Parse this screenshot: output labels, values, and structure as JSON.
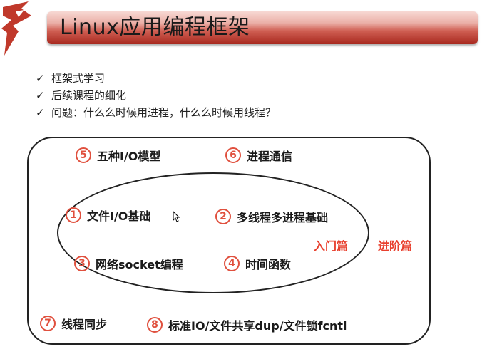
{
  "slide": {
    "title": "Linux应用编程框架",
    "bullets": [
      {
        "check": "✓",
        "text": "框架式学习"
      },
      {
        "check": "✓",
        "text": "后续课程的细化"
      },
      {
        "check": "✓",
        "text": "问题：什么么时候用进程，什么么时候用线程？"
      }
    ],
    "diagram": {
      "items": [
        {
          "num": "5",
          "label": "五种I/O模型"
        },
        {
          "num": "6",
          "label": "进程通信"
        },
        {
          "num": "1",
          "label": "文件I/O基础"
        },
        {
          "num": "2",
          "label": "多线程多进程基础"
        },
        {
          "num": "3",
          "label": "网络socket编程"
        },
        {
          "num": "4",
          "label": "时间函数"
        },
        {
          "num": "7",
          "label": "线程同步"
        },
        {
          "num": "8",
          "label": "标准IO/文件共享dup/文件锁fcntl"
        }
      ],
      "tag_intro": "入门篇",
      "tag_advanced": "进阶篇"
    }
  },
  "colors": {
    "title_bar_dark": "#a8291f",
    "accent_red": "#e8402e",
    "circle_red": "#e0503e"
  }
}
